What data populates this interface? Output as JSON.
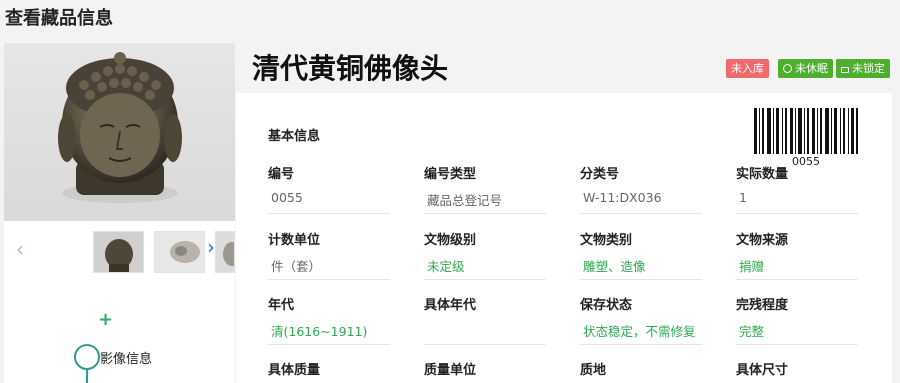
{
  "page": {
    "title": "查看藏品信息"
  },
  "object": {
    "name": "清代黄铜佛像头",
    "tags": [
      "未入库",
      "未休眠",
      "未锁定"
    ],
    "barcode_number": "0055"
  },
  "gallery": {
    "prev_label": "‹",
    "next_label": "›",
    "add_label": "+",
    "timeline_label": "影像信息"
  },
  "section": {
    "title": "基本信息"
  },
  "fields": [
    {
      "label": "编号",
      "value": "0055",
      "color": "gray"
    },
    {
      "label": "编号类型",
      "value": "藏品总登记号",
      "color": "gray"
    },
    {
      "label": "分类号",
      "value": "W-11:DX036",
      "color": "gray"
    },
    {
      "label": "实际数量",
      "value": "1",
      "color": "gray"
    },
    {
      "label": "计数单位",
      "value": "件（套）",
      "color": "gray"
    },
    {
      "label": "文物级别",
      "value": "未定级",
      "color": "green"
    },
    {
      "label": "文物类别",
      "value": "雕塑、造像",
      "color": "green"
    },
    {
      "label": "文物来源",
      "value": "捐赠",
      "color": "green"
    },
    {
      "label": "年代",
      "value": "清(1616~1911)",
      "color": "green"
    },
    {
      "label": "具体年代",
      "value": "",
      "color": "gray"
    },
    {
      "label": "保存状态",
      "value": "状态稳定，不需修复",
      "color": "green"
    },
    {
      "label": "完残程度",
      "value": "完整",
      "color": "green"
    },
    {
      "label": "具体质量",
      "value": "",
      "color": "gray"
    },
    {
      "label": "质量单位",
      "value": "",
      "color": "gray"
    },
    {
      "label": "质地",
      "value": "",
      "color": "gray"
    },
    {
      "label": "具体尺寸",
      "value": "",
      "color": "gray"
    }
  ]
}
